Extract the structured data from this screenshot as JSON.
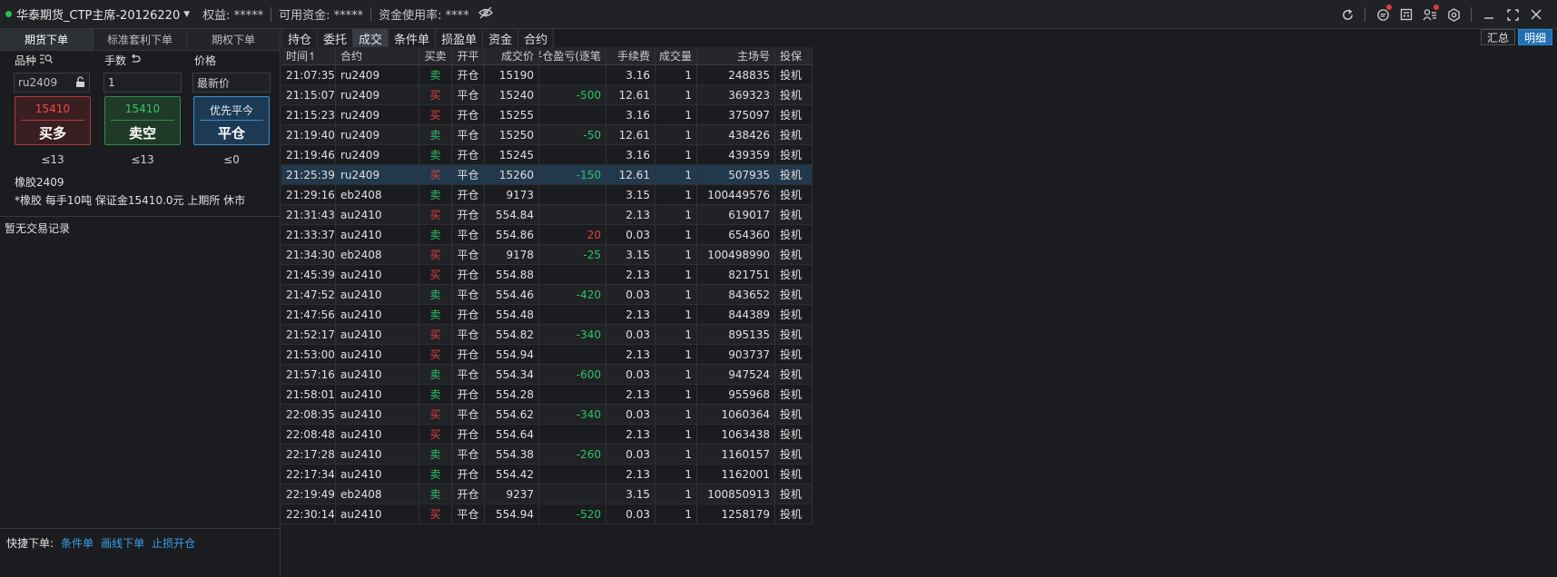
{
  "top_bar": {
    "account": "华泰期货_CTP主席-20126220",
    "equity": "权益: *****",
    "available": "可用资金: *****",
    "usage": "资金使用率: ****",
    "icons": [
      "refresh-icon",
      "chat-icon",
      "calculator-icon",
      "user-list-icon",
      "settings-icon",
      "minimize-icon",
      "fullscreen-icon",
      "close-icon"
    ]
  },
  "left": {
    "tabs": [
      "期货下单",
      "标准套利下单",
      "期权下单"
    ],
    "labels": {
      "instrument": "品种",
      "lots": "手数",
      "price": "价格"
    },
    "instrument_value": "ru2409",
    "lots_value": "1",
    "price_value": "最新价",
    "buy": {
      "price": "15410",
      "label": "买多",
      "limit": "≤13"
    },
    "sell": {
      "price": "15410",
      "label": "卖空",
      "limit": "≤13"
    },
    "close": {
      "price": "优先平今",
      "label": "平仓",
      "limit": "≤0"
    },
    "contract_name": "橡胶2409",
    "contract_info": "*橡胶 每手10吨 保证金15410.0元 上期所 休市",
    "no_trade": "暂无交易记录",
    "quick": {
      "label": "快捷下单:",
      "links": [
        "条件单",
        "画线下单",
        "止损开仓"
      ]
    }
  },
  "tabs": [
    "持仓",
    "委托",
    "成交",
    "条件单",
    "损盈单",
    "资金",
    "合约"
  ],
  "active_tab": "成交",
  "switch": {
    "summary": "汇总",
    "detail": "明细"
  },
  "table": {
    "headers": [
      "时间↿",
      "合约",
      "买卖",
      "开平",
      "成交价",
      "平仓盈亏(逐笔",
      "手续费",
      "成交量",
      "主场号",
      "投保"
    ],
    "rows": [
      [
        "21:07:35",
        "ru2409",
        "卖",
        "开仓",
        "15190",
        "",
        "3.16",
        "1",
        "248835",
        "投机"
      ],
      [
        "21:15:07",
        "ru2409",
        "买",
        "平仓",
        "15240",
        "-500",
        "12.61",
        "1",
        "369323",
        "投机"
      ],
      [
        "21:15:23",
        "ru2409",
        "买",
        "开仓",
        "15255",
        "",
        "3.16",
        "1",
        "375097",
        "投机"
      ],
      [
        "21:19:40",
        "ru2409",
        "卖",
        "平仓",
        "15250",
        "-50",
        "12.61",
        "1",
        "438426",
        "投机"
      ],
      [
        "21:19:46",
        "ru2409",
        "卖",
        "开仓",
        "15245",
        "",
        "3.16",
        "1",
        "439359",
        "投机"
      ],
      [
        "21:25:39",
        "ru2409",
        "买",
        "平仓",
        "15260",
        "-150",
        "12.61",
        "1",
        "507935",
        "投机"
      ],
      [
        "21:29:16",
        "eb2408",
        "卖",
        "开仓",
        "9173",
        "",
        "3.15",
        "1",
        "100449576",
        "投机"
      ],
      [
        "21:31:43",
        "au2410",
        "买",
        "开仓",
        "554.84",
        "",
        "2.13",
        "1",
        "619017",
        "投机"
      ],
      [
        "21:33:37",
        "au2410",
        "卖",
        "平仓",
        "554.86",
        "20",
        "0.03",
        "1",
        "654360",
        "投机"
      ],
      [
        "21:34:30",
        "eb2408",
        "买",
        "平仓",
        "9178",
        "-25",
        "3.15",
        "1",
        "100498990",
        "投机"
      ],
      [
        "21:45:39",
        "au2410",
        "买",
        "开仓",
        "554.88",
        "",
        "2.13",
        "1",
        "821751",
        "投机"
      ],
      [
        "21:47:52",
        "au2410",
        "卖",
        "平仓",
        "554.46",
        "-420",
        "0.03",
        "1",
        "843652",
        "投机"
      ],
      [
        "21:47:56",
        "au2410",
        "卖",
        "开仓",
        "554.48",
        "",
        "2.13",
        "1",
        "844389",
        "投机"
      ],
      [
        "21:52:17",
        "au2410",
        "买",
        "平仓",
        "554.82",
        "-340",
        "0.03",
        "1",
        "895135",
        "投机"
      ],
      [
        "21:53:00",
        "au2410",
        "买",
        "开仓",
        "554.94",
        "",
        "2.13",
        "1",
        "903737",
        "投机"
      ],
      [
        "21:57:16",
        "au2410",
        "卖",
        "平仓",
        "554.34",
        "-600",
        "0.03",
        "1",
        "947524",
        "投机"
      ],
      [
        "21:58:01",
        "au2410",
        "卖",
        "开仓",
        "554.28",
        "",
        "2.13",
        "1",
        "955968",
        "投机"
      ],
      [
        "22:08:35",
        "au2410",
        "买",
        "平仓",
        "554.62",
        "-340",
        "0.03",
        "1",
        "1060364",
        "投机"
      ],
      [
        "22:08:48",
        "au2410",
        "买",
        "开仓",
        "554.64",
        "",
        "2.13",
        "1",
        "1063438",
        "投机"
      ],
      [
        "22:17:28",
        "au2410",
        "卖",
        "平仓",
        "554.38",
        "-260",
        "0.03",
        "1",
        "1160157",
        "投机"
      ],
      [
        "22:17:34",
        "au2410",
        "卖",
        "开仓",
        "554.42",
        "",
        "2.13",
        "1",
        "1162001",
        "投机"
      ],
      [
        "22:19:49",
        "eb2408",
        "卖",
        "开仓",
        "9237",
        "",
        "3.15",
        "1",
        "100850913",
        "投机"
      ],
      [
        "22:30:14",
        "au2410",
        "买",
        "平仓",
        "554.94",
        "-520",
        "0.03",
        "1",
        "1258179",
        "投机"
      ]
    ],
    "selected_row": 5
  },
  "colors": {
    "buy": "#e84040",
    "sell": "#2ec26a",
    "accent": "#1f6fb2"
  }
}
